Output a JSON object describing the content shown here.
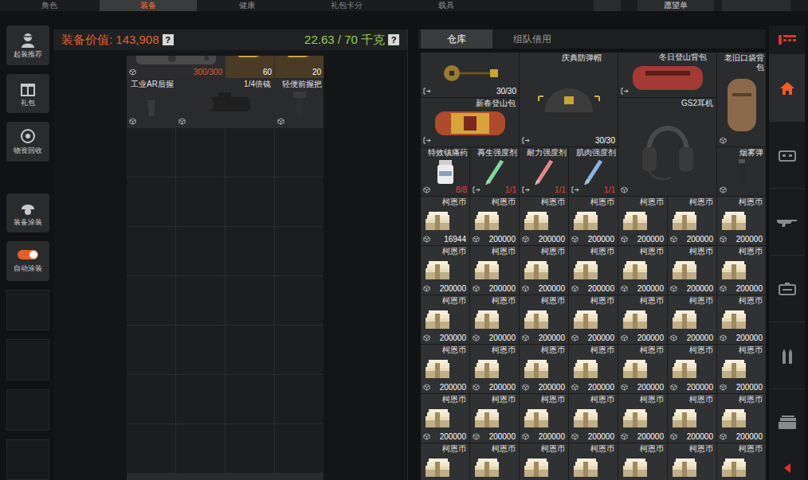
{
  "top_tabs": [
    {
      "label": "角色",
      "selected": false
    },
    {
      "label": "装备",
      "selected": true
    },
    {
      "label": "健康",
      "selected": false
    },
    {
      "label": "礼包卡分",
      "selected": false
    },
    {
      "label": "载具",
      "selected": false
    }
  ],
  "wishlist": "愿望单",
  "side_menu": [
    {
      "label": "起装推荐"
    },
    {
      "label": "礼包"
    },
    {
      "label": "物资回收"
    },
    {
      "label": "装备涂装"
    }
  ],
  "auto_skin": {
    "label": "自动涂装",
    "on": true
  },
  "loadout": {
    "value": "装备价值: 143,908",
    "value_help": "?",
    "weight": "22.63 / 70 千克",
    "weight_help": "?",
    "items": [
      {
        "count": "300/300",
        "color": "#e2582d"
      },
      {
        "count": "60",
        "color": "#ffffff"
      },
      {
        "count": "20",
        "color": "#ffffff"
      },
      {
        "name": "工业AR后握"
      },
      {
        "name": "1/4倍镜"
      },
      {
        "name": "轻便前握把"
      }
    ]
  },
  "storage_tabs": [
    {
      "label": "仓库",
      "selected": true
    },
    {
      "label": "组队借用",
      "selected": false
    }
  ],
  "storage_items": [
    {
      "count": "30/30",
      "color": "#ffffff"
    },
    {
      "name": "庆典防弹帽",
      "count": "30/30",
      "color": "#ffffff"
    },
    {
      "name": "冬日登山背包"
    },
    {
      "name": "老旧口袋背包"
    },
    {
      "name": "新春登山包"
    },
    {
      "name": "GS2耳机"
    },
    {
      "name": "特效镇痛药",
      "count": "8/8",
      "color": "#e8442e"
    },
    {
      "name": "再生强度剂",
      "count": "1/1",
      "color": "#e8442e"
    },
    {
      "name": "耐力强度剂",
      "count": "1/1",
      "color": "#e8442e"
    },
    {
      "name": "肌肉强度剂",
      "count": "1/1",
      "color": "#e8442e"
    },
    {
      "name": "烟雾弹"
    }
  ],
  "money": [
    {
      "label": "柯恩币",
      "amount": "16944"
    },
    {
      "label": "柯恩币",
      "amount": "200000"
    },
    {
      "label": "柯恩币",
      "amount": "200000"
    },
    {
      "label": "柯恩币",
      "amount": "200000"
    },
    {
      "label": "柯恩币",
      "amount": "200000"
    },
    {
      "label": "柯恩币",
      "amount": "200000"
    },
    {
      "label": "柯恩币",
      "amount": "200000"
    },
    {
      "label": "柯恩币",
      "amount": "200000"
    },
    {
      "label": "柯恩币",
      "amount": "200000"
    },
    {
      "label": "柯恩币",
      "amount": "200000"
    },
    {
      "label": "柯恩币",
      "amount": "200000"
    },
    {
      "label": "柯恩币",
      "amount": "200000"
    },
    {
      "label": "柯恩币",
      "amount": "200000"
    },
    {
      "label": "柯恩币",
      "amount": "200000"
    },
    {
      "label": "柯恩币",
      "amount": "200000"
    },
    {
      "label": "柯恩币",
      "amount": "200000"
    },
    {
      "label": "柯恩币",
      "amount": "200000"
    },
    {
      "label": "柯恩币",
      "amount": "200000"
    },
    {
      "label": "柯恩币",
      "amount": "200000"
    },
    {
      "label": "柯恩币",
      "amount": "200000"
    },
    {
      "label": "柯恩币",
      "amount": "200000"
    },
    {
      "label": "柯恩币",
      "amount": "200000"
    },
    {
      "label": "柯恩币",
      "amount": "200000"
    },
    {
      "label": "柯恩币",
      "amount": "200000"
    },
    {
      "label": "柯恩币",
      "amount": "200000"
    },
    {
      "label": "柯恩币",
      "amount": "200000"
    },
    {
      "label": "柯恩币",
      "amount": "200000"
    },
    {
      "label": "柯恩币",
      "amount": "200000"
    },
    {
      "label": "柯恩币",
      "amount": "200000"
    },
    {
      "label": "柯恩币",
      "amount": "200000"
    },
    {
      "label": "柯恩币",
      "amount": "200000"
    },
    {
      "label": "柯恩币",
      "amount": "200000"
    },
    {
      "label": "柯恩币",
      "amount": "200000"
    },
    {
      "label": "柯恩币",
      "amount": "200000"
    },
    {
      "label": "柯恩币",
      "amount": "200000"
    }
  ],
  "money_cut": [
    {
      "label": "柯恩币"
    },
    {
      "label": "柯恩币"
    },
    {
      "label": "柯恩币"
    },
    {
      "label": "柯恩币"
    },
    {
      "label": "柯恩币"
    },
    {
      "label": "柯恩币"
    },
    {
      "label": "柯恩币"
    }
  ],
  "category_rail": [
    {
      "selected": true
    },
    {
      "selected": false
    },
    {
      "selected": false
    },
    {
      "selected": false
    },
    {
      "selected": false
    },
    {
      "selected": false
    }
  ]
}
